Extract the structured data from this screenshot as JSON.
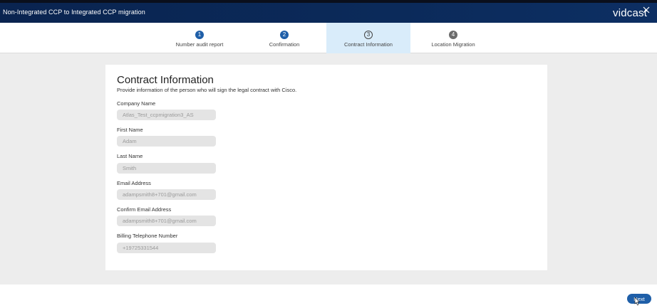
{
  "header": {
    "title": "Non-Integrated CCP to Integrated CCP migration",
    "logo": "vidcast"
  },
  "stepper": {
    "steps": [
      {
        "number": "1",
        "label": "Number audit report",
        "state": "done"
      },
      {
        "number": "2",
        "label": "Confirmation",
        "state": "done"
      },
      {
        "number": "3",
        "label": "Contract Information",
        "state": "active"
      },
      {
        "number": "4",
        "label": "Location Migration",
        "state": "pending"
      }
    ]
  },
  "form": {
    "title": "Contract Information",
    "description": "Provide information of the person who will sign the legal contract with Cisco.",
    "fields": [
      {
        "label": "Company Name",
        "value": "Atlas_Test_ccpmigration3_AS"
      },
      {
        "label": "First Name",
        "value": "Adam"
      },
      {
        "label": "Last Name",
        "value": "Smith"
      },
      {
        "label": "Email Address",
        "value": "adampsmith8+701@gmail.com"
      },
      {
        "label": "Confirm Email Address",
        "value": "adampsmith8+701@gmail.com"
      },
      {
        "label": "Billing Telephone Number",
        "value": "+19725331544"
      }
    ]
  },
  "footer": {
    "next_label": "Next"
  },
  "colors": {
    "header_bg": "#0b2a5a",
    "primary": "#1f5fa8",
    "active_step_bg": "#d9ecfa"
  }
}
